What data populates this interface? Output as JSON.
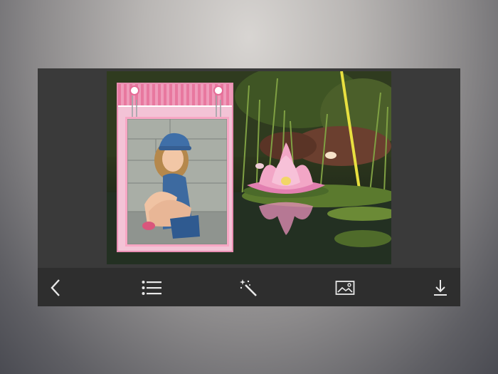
{
  "colors": {
    "toolbar_bg": "#2e2e2e",
    "panel_bg": "#3a3a3a",
    "icon": "#e8e8e8",
    "frame_pink": "#f3c3d6",
    "lotus_pink": "#f2a6c6"
  },
  "toolbar": {
    "items": [
      {
        "icon": "back-chevron-icon"
      },
      {
        "icon": "list-icon"
      },
      {
        "icon": "magic-wand-icon"
      },
      {
        "icon": "image-icon"
      },
      {
        "icon": "download-icon"
      }
    ]
  }
}
